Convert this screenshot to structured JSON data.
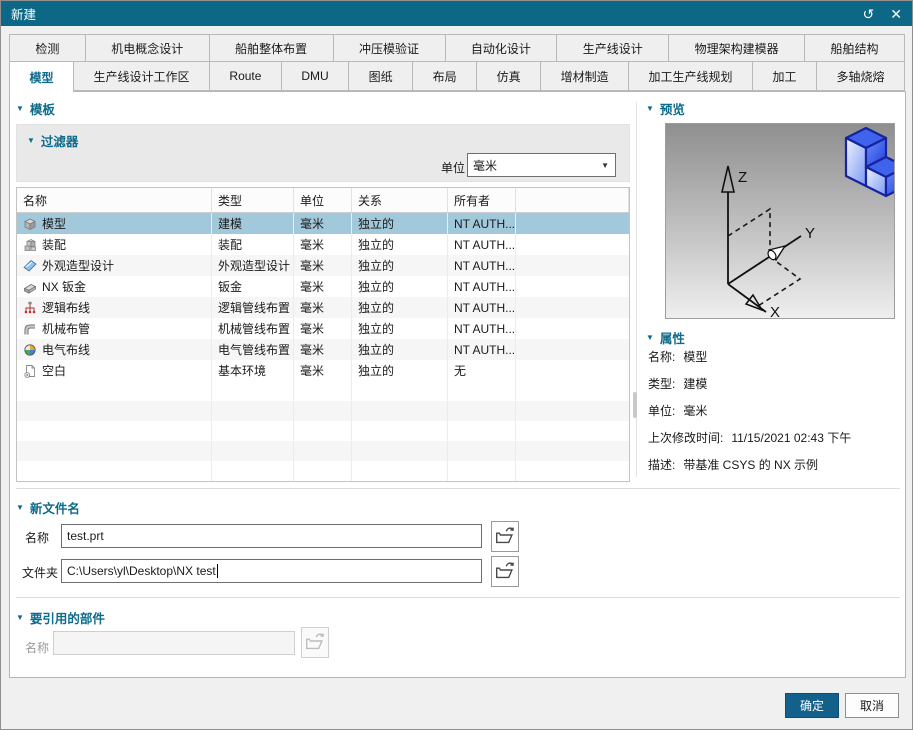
{
  "window": {
    "title": "新建",
    "refresh_icon": "↺",
    "close_icon": "✕"
  },
  "colors": {
    "accent": "#0e6b8c",
    "titlebar": "#0d6887",
    "selection": "#a2c9db",
    "ok_button": "#13608b"
  },
  "tabs": {
    "row1": [
      {
        "label": "检测"
      },
      {
        "label": "机电概念设计"
      },
      {
        "label": "船舶整体布置"
      },
      {
        "label": "冲压模验证"
      },
      {
        "label": "自动化设计"
      },
      {
        "label": "生产线设计"
      },
      {
        "label": "物理架构建模器"
      },
      {
        "label": "船舶结构"
      }
    ],
    "row2": [
      {
        "label": "模型",
        "active": true
      },
      {
        "label": "生产线设计工作区"
      },
      {
        "label": "Route"
      },
      {
        "label": "DMU"
      },
      {
        "label": "图纸"
      },
      {
        "label": "布局"
      },
      {
        "label": "仿真"
      },
      {
        "label": "增材制造"
      },
      {
        "label": "加工生产线规划"
      },
      {
        "label": "加工"
      },
      {
        "label": "多轴烧熔"
      }
    ]
  },
  "template_section": {
    "title": "模板"
  },
  "filter": {
    "title": "过滤器",
    "units_label": "单位",
    "units_value": "毫米",
    "dropdown_arrow": "▼"
  },
  "table": {
    "columns": [
      "名称",
      "类型",
      "单位",
      "关系",
      "所有者"
    ],
    "rows": [
      {
        "icon": "model-icon",
        "name": "模型",
        "type": "建模",
        "units": "毫米",
        "relationship": "独立的",
        "owner": "NT AUTH...",
        "selected": true
      },
      {
        "icon": "assembly-icon",
        "name": "装配",
        "type": "装配",
        "units": "毫米",
        "relationship": "独立的",
        "owner": "NT AUTH..."
      },
      {
        "icon": "shape-studio-icon",
        "name": "外观造型设计",
        "type": "外观造型设计",
        "units": "毫米",
        "relationship": "独立的",
        "owner": "NT AUTH..."
      },
      {
        "icon": "sheet-metal-icon",
        "name": "NX 钣金",
        "type": "钣金",
        "units": "毫米",
        "relationship": "独立的",
        "owner": "NT AUTH..."
      },
      {
        "icon": "logical-routing-icon",
        "name": "逻辑布线",
        "type": "逻辑管线布置",
        "units": "毫米",
        "relationship": "独立的",
        "owner": "NT AUTH..."
      },
      {
        "icon": "mechanical-routing-icon",
        "name": "机械布管",
        "type": "机械管线布置",
        "units": "毫米",
        "relationship": "独立的",
        "owner": "NT AUTH..."
      },
      {
        "icon": "electrical-routing-icon",
        "name": "电气布线",
        "type": "电气管线布置",
        "units": "毫米",
        "relationship": "独立的",
        "owner": "NT AUTH..."
      },
      {
        "icon": "blank-icon",
        "name": "空白",
        "type": "基本环境",
        "units": "毫米",
        "relationship": "独立的",
        "owner": "无"
      }
    ]
  },
  "preview": {
    "title": "预览",
    "axis_x": "X",
    "axis_y": "Y",
    "axis_z": "Z"
  },
  "properties": {
    "title": "属性",
    "items": [
      {
        "label": "名称:",
        "value": "模型"
      },
      {
        "label": "类型:",
        "value": "建模"
      },
      {
        "label": "单位:",
        "value": "毫米"
      },
      {
        "label": "上次修改时间:",
        "value": "11/15/2021 02:43 下午"
      },
      {
        "label": "描述:",
        "value": "带基准 CSYS 的 NX 示例"
      }
    ]
  },
  "new_file": {
    "title": "新文件名",
    "name_label": "名称",
    "name_value": "test.prt",
    "folder_label": "文件夹",
    "folder_value": "C:\\Users\\yl\\Desktop\\NX test"
  },
  "reference": {
    "title": "要引用的部件",
    "name_label": "名称",
    "name_value": ""
  },
  "footer": {
    "ok_label": "确定",
    "cancel_label": "取消"
  }
}
